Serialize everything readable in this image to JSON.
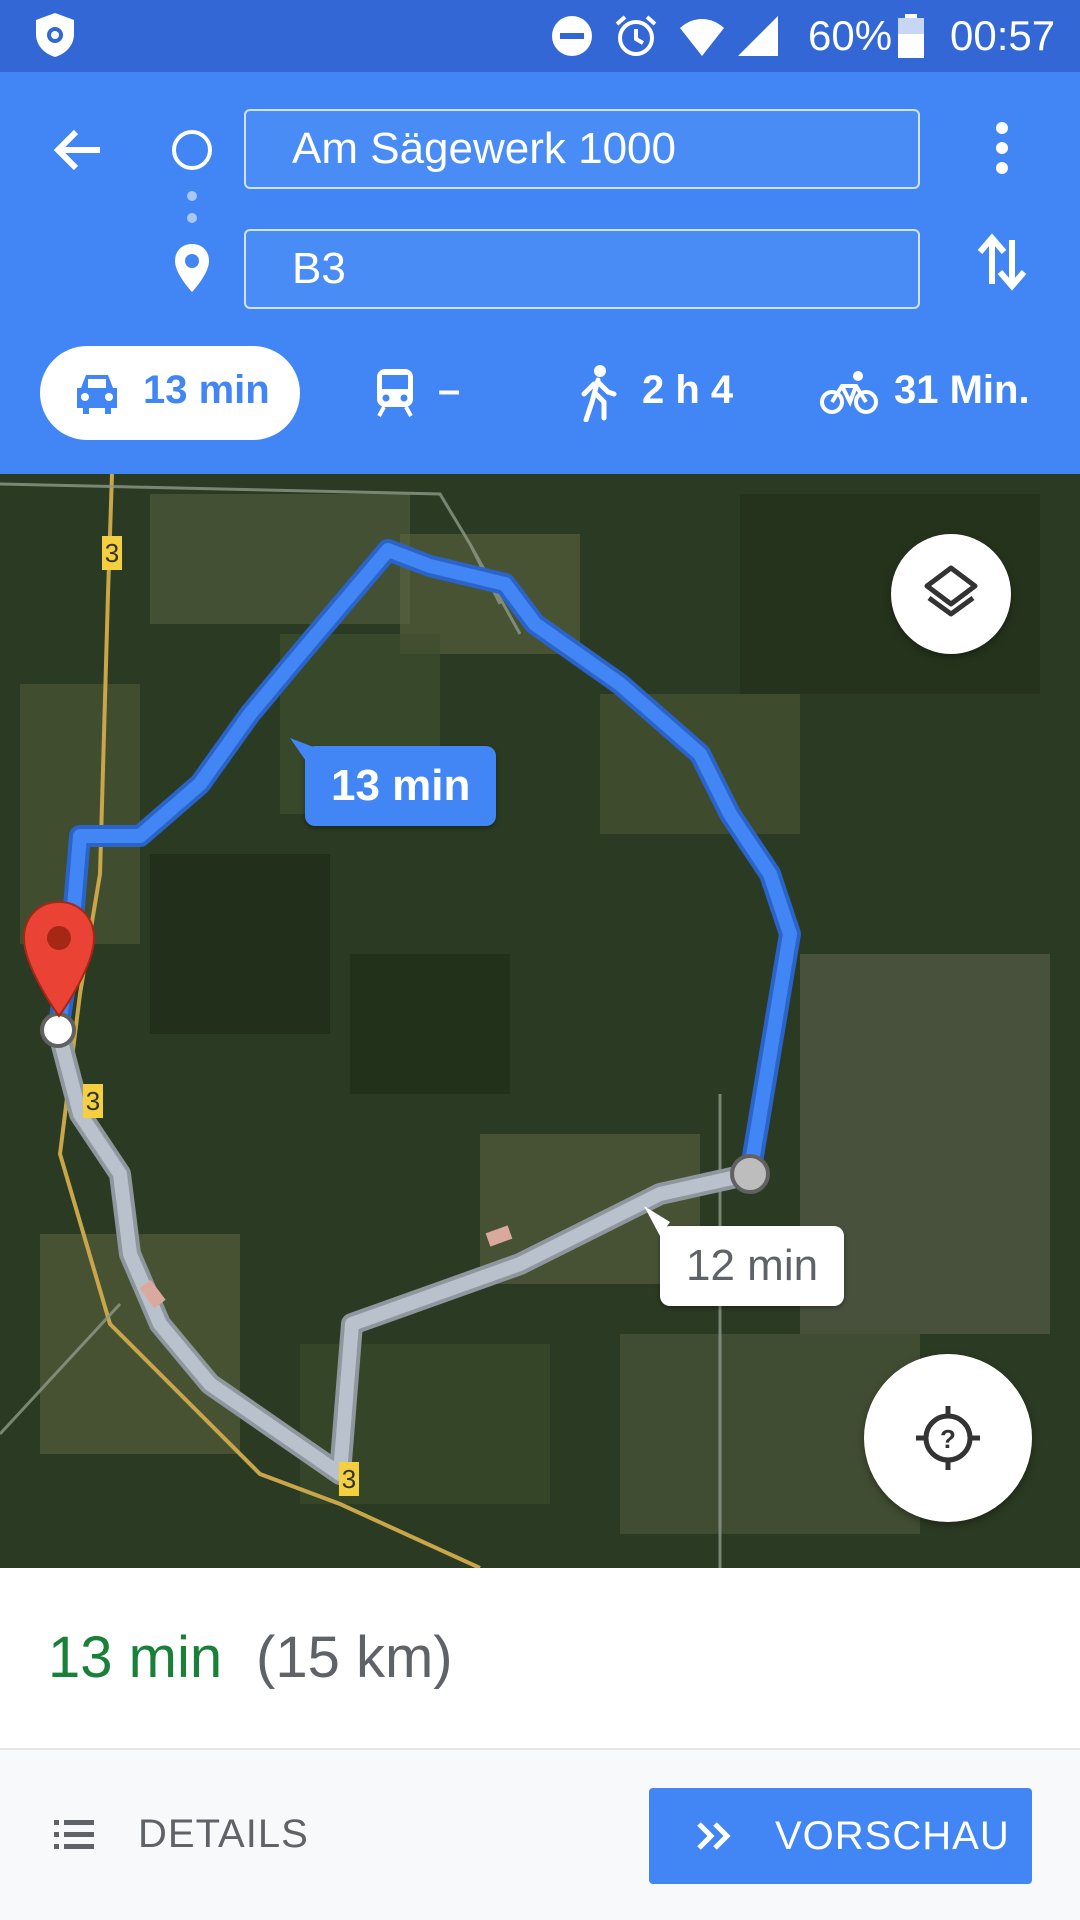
{
  "status_bar": {
    "battery": "60%",
    "time": "00:57",
    "icons": [
      "app-shield-icon",
      "dnd-icon",
      "alarm-icon",
      "wifi-icon",
      "signal-icon",
      "battery-icon"
    ]
  },
  "header": {
    "origin_value": "Am Sägewerk 1000",
    "destination_value": "B3",
    "icons": [
      "back-arrow-icon",
      "origin-circle-icon",
      "destination-pin-icon",
      "more-vert-icon",
      "swap-icon"
    ]
  },
  "modes": [
    {
      "name": "drive",
      "icon": "car-icon",
      "label": "13 min",
      "selected": true
    },
    {
      "name": "transit",
      "icon": "train-icon",
      "label": "–",
      "selected": false
    },
    {
      "name": "walk",
      "icon": "walk-icon",
      "label": "2 h 4",
      "selected": false
    },
    {
      "name": "bike",
      "icon": "bike-icon",
      "label": "31 Min.",
      "selected": false
    }
  ],
  "map": {
    "road_badges": [
      "3",
      "3",
      "3"
    ],
    "selected_route_label": "13 min",
    "alternate_route_label": "12 min",
    "icons": [
      "layers-icon",
      "my-location-icon",
      "destination-marker-icon"
    ],
    "route_color": "#4285f4",
    "alternate_color": "#b9c2cc"
  },
  "summary": {
    "time": "13 min",
    "distance": "(15 km)",
    "time_color": "#188038"
  },
  "bottom_bar": {
    "details_label": "DETAILS",
    "preview_label": "VORSCHAU",
    "icons": [
      "list-icon",
      "double-chevron-icon"
    ]
  }
}
